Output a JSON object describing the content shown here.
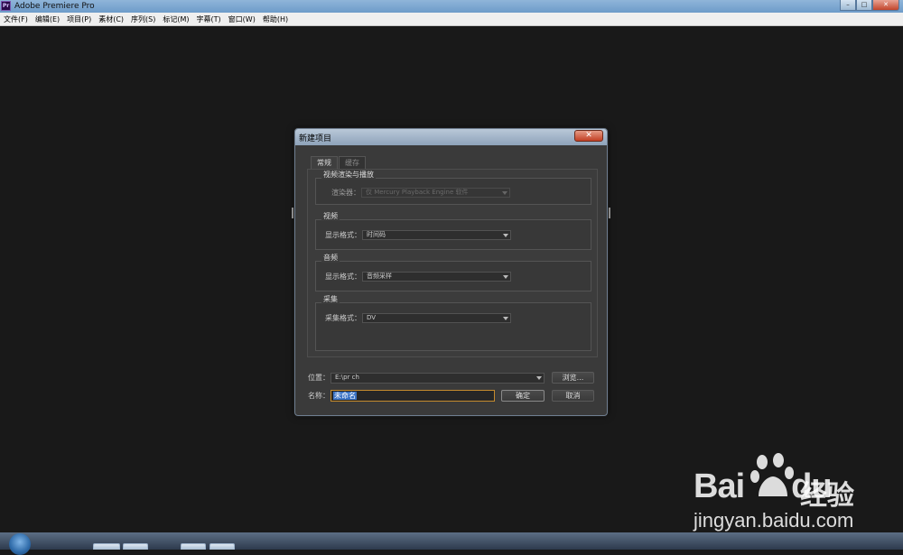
{
  "window": {
    "title": "Adobe Premiere Pro",
    "app_icon": "Pr",
    "minimize": "–",
    "maximize": "□",
    "close": "✕"
  },
  "menu": [
    "文件(F)",
    "编辑(E)",
    "项目(P)",
    "素材(C)",
    "序列(S)",
    "标记(M)",
    "字幕(T)",
    "窗口(W)",
    "帮助(H)"
  ],
  "dialog": {
    "title": "新建项目",
    "close_glyph": "✕",
    "tabs": [
      "常规",
      "缓存"
    ],
    "groups": {
      "render": {
        "title": "视频渲染与播放",
        "label": "渲染器：",
        "value": "仅 Mercury Playback Engine 软件"
      },
      "video": {
        "title": "视频",
        "label": "显示格式：",
        "value": "时间码"
      },
      "audio": {
        "title": "音频",
        "label": "显示格式：",
        "value": "音频采样"
      },
      "capture": {
        "title": "采集",
        "label": "采集格式：",
        "value": "DV"
      }
    },
    "location": {
      "label": "位置：",
      "value": "E:\\pr ch",
      "browse": "浏览..."
    },
    "name": {
      "label": "名称：",
      "value": "未命名"
    },
    "ok": "确定",
    "cancel": "取消"
  },
  "watermark": {
    "logo": "Bai",
    "logo_tail": "du",
    "cn": "经验",
    "url": "jingyan.baidu.com"
  }
}
